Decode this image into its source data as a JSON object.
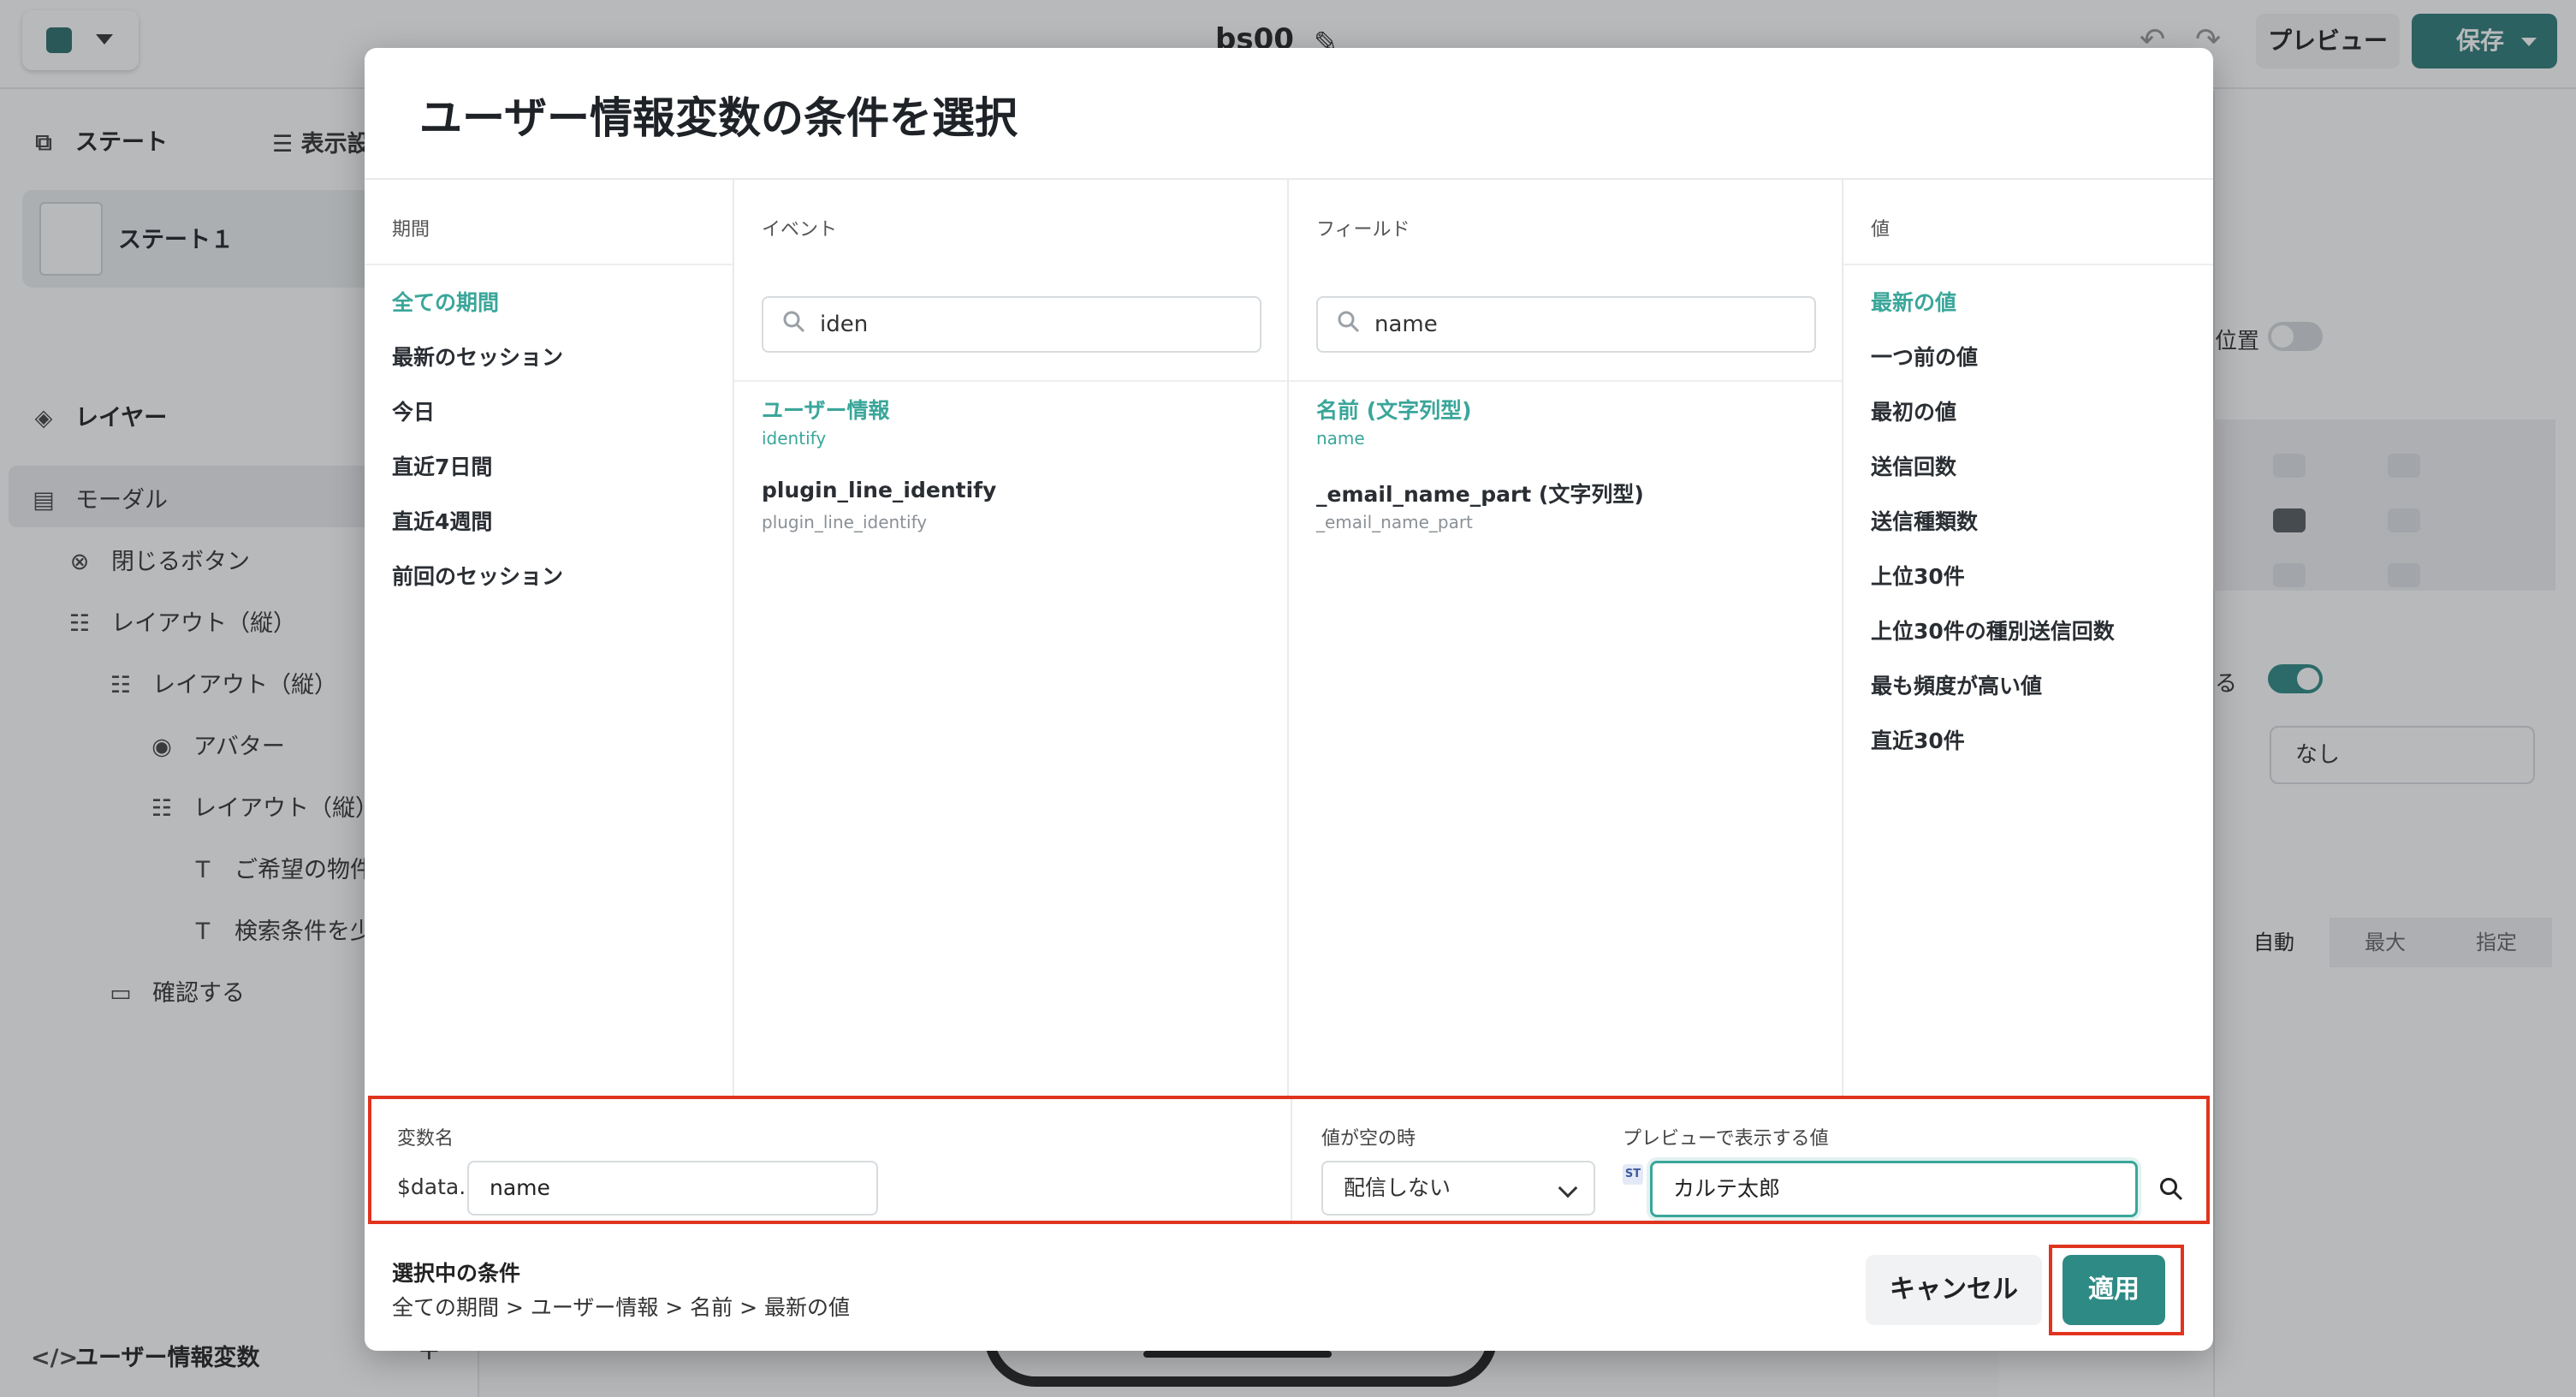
{
  "app": {
    "doc_title": "bs00",
    "preview_label": "プレビュー",
    "save_label": "保存"
  },
  "left_panel": {
    "states_title": "ステート",
    "display_settings": "表示設定",
    "state_item": "ステート１",
    "layers_title": "レイヤー",
    "layers": [
      {
        "label": "モーダル",
        "icon": "modal-icon"
      },
      {
        "label": "閉じるボタン",
        "icon": "close-circle-icon"
      },
      {
        "label": "レイアウト（縦）",
        "icon": "layout-icon"
      },
      {
        "label": "レイアウト（縦）",
        "icon": "layout-icon"
      },
      {
        "label": "アバター",
        "icon": "avatar-icon"
      },
      {
        "label": "レイアウト（縦）",
        "icon": "layout-icon"
      },
      {
        "label": "ご希望の物件に",
        "icon": "text-icon"
      },
      {
        "label": "検索条件を少し",
        "icon": "text-icon"
      },
      {
        "label": "確認する",
        "icon": "button-icon"
      }
    ],
    "user_vars_title": "ユーザー情報変数",
    "add_label": "+"
  },
  "right_panel": {
    "position_label": "位置",
    "show_label": "る",
    "select_value": "なし",
    "segments": [
      "自動",
      "最大",
      "指定"
    ]
  },
  "modal": {
    "title": "ユーザー情報変数の条件を選択",
    "period": {
      "header": "期間",
      "options": [
        "全ての期間",
        "最新のセッション",
        "今日",
        "直近7日間",
        "直近4週間",
        "前回のセッション"
      ],
      "selected": "全ての期間"
    },
    "event": {
      "header": "イベント",
      "search_value": "iden",
      "items": [
        {
          "label": "ユーザー情報",
          "sub": "identify",
          "selected": true
        },
        {
          "label": "plugin_line_identify",
          "sub": "plugin_line_identify",
          "selected": false
        }
      ]
    },
    "field": {
      "header": "フィールド",
      "search_value": "name",
      "items": [
        {
          "label": "名前 (文字列型)",
          "sub": "name",
          "selected": true
        },
        {
          "label": "_email_name_part (文字列型)",
          "sub": "_email_name_part",
          "selected": false
        }
      ]
    },
    "value": {
      "header": "値",
      "options": [
        "最新の値",
        "一つ前の値",
        "最初の値",
        "送信回数",
        "送信種類数",
        "上位30件",
        "上位30件の種別送信回数",
        "最も頻度が高い値",
        "直近30件"
      ],
      "selected": "最新の値"
    },
    "variable": {
      "name_label": "変数名",
      "prefix": "$data.",
      "name_value": "name",
      "empty_label": "値が空の時",
      "empty_value": "配信しない",
      "preview_label": "プレビューで表示する値",
      "type_badge": "ST",
      "preview_value": "カルテ太郎"
    },
    "footer": {
      "selected_title": "選択中の条件",
      "selected_path": "全ての期間 > ユーザー情報 > 名前 > 最新の値",
      "cancel_label": "キャンセル",
      "apply_label": "適用"
    }
  },
  "colors": {
    "accent": "#3aa69a",
    "primary_button": "#2e8a84",
    "highlight_outline": "#e0341f"
  }
}
